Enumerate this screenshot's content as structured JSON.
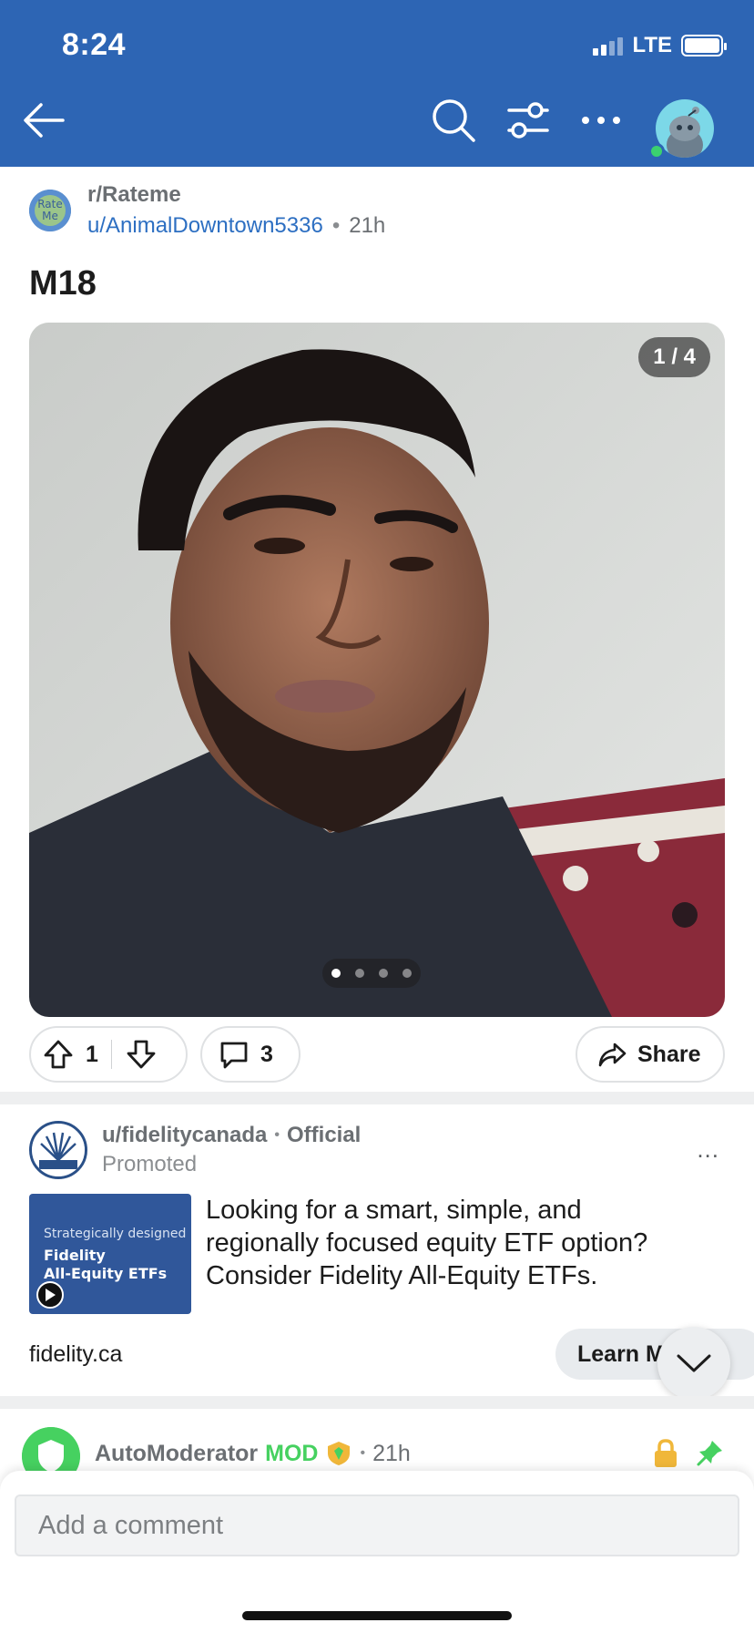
{
  "status_bar": {
    "time": "8:24",
    "network": "LTE"
  },
  "header": {
    "icons": [
      "back-arrow-icon",
      "search-icon",
      "filter-sort-icon",
      "more-icon",
      "user-avatar"
    ]
  },
  "post": {
    "subreddit": "r/Rateme",
    "subreddit_icon_text": "Rate Me",
    "author": "u/AnimalDowntown5336",
    "separator": "•",
    "age": "21h",
    "title": "M18",
    "image_counter": "1 / 4",
    "image_count": 4,
    "current_image": 1,
    "votes": "1",
    "comments": "3",
    "share_label": "Share"
  },
  "ad": {
    "author": "u/fidelitycanada",
    "separator": "•",
    "badge": "Official",
    "promoted_label": "Promoted",
    "more_label": "...",
    "thumb_small": "Strategically designed",
    "thumb_line1": "Fidelity",
    "thumb_line2": "All-Equity ETFs",
    "text": "Looking for a smart, simple, and regionally focused equity ETF option? Consider Fidelity All-Equity ETFs.",
    "domain": "fidelity.ca",
    "cta_label": "Learn More"
  },
  "automod": {
    "name": "AutoModerator",
    "mod_label": "MOD",
    "separator": "•",
    "age": "21h"
  },
  "comment_bar": {
    "placeholder": "Add a comment"
  },
  "colors": {
    "header_bg": "#2d65b4",
    "username": "#2d6fc2",
    "mod_green": "#46d160"
  }
}
